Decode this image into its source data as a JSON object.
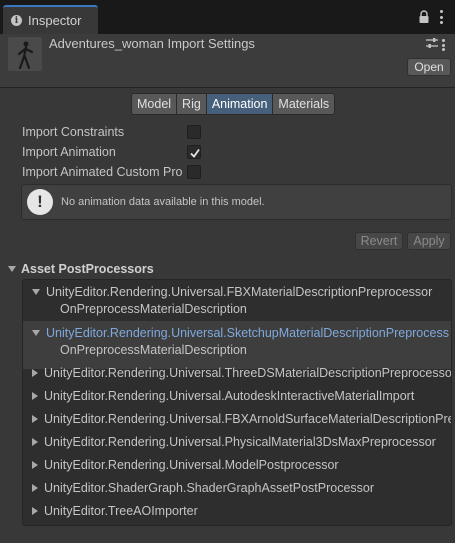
{
  "tab": {
    "title": "Inspector",
    "icon": "info-icon"
  },
  "header": {
    "title": "Adventures_woman Import Settings",
    "open_label": "Open"
  },
  "mode_tabs": [
    {
      "label": "Model",
      "active": false
    },
    {
      "label": "Rig",
      "active": false
    },
    {
      "label": "Animation",
      "active": true
    },
    {
      "label": "Materials",
      "active": false
    }
  ],
  "options": [
    {
      "label": "Import Constraints",
      "checked": false
    },
    {
      "label": "Import Animation",
      "checked": true
    },
    {
      "label": "Import Animated Custom Pro",
      "checked": false
    }
  ],
  "help": {
    "message": "No animation data available in this model.",
    "icon": "warning-icon"
  },
  "buttons": {
    "revert": "Revert",
    "apply": "Apply"
  },
  "postprocessors": {
    "title": "Asset PostProcessors",
    "items": [
      {
        "label": "UnityEditor.Rendering.Universal.FBXMaterialDescriptionPreprocessor",
        "expanded": true,
        "child": "OnPreprocessMaterialDescription"
      },
      {
        "label": "UnityEditor.Rendering.Universal.SketchupMaterialDescriptionPreprocess",
        "expanded": true,
        "child": "OnPreprocessMaterialDescription",
        "selected": true
      },
      {
        "label": "UnityEditor.Rendering.Universal.ThreeDSMaterialDescriptionPreprocesso",
        "expanded": false
      },
      {
        "label": "UnityEditor.Rendering.Universal.AutodeskInteractiveMaterialImport",
        "expanded": false
      },
      {
        "label": "UnityEditor.Rendering.Universal.FBXArnoldSurfaceMaterialDescriptionPre",
        "expanded": false
      },
      {
        "label": "UnityEditor.Rendering.Universal.PhysicalMaterial3DsMaxPreprocessor",
        "expanded": false
      },
      {
        "label": "UnityEditor.Rendering.Universal.ModelPostprocessor",
        "expanded": false
      },
      {
        "label": "UnityEditor.ShaderGraph.ShaderGraphAssetPostProcessor",
        "expanded": false
      },
      {
        "label": "UnityEditor.TreeAOImporter",
        "expanded": false
      }
    ]
  },
  "colors": {
    "accent": "#46607c",
    "highlight_text": "#7fa9dc",
    "tab_border": "#3a79bb"
  }
}
